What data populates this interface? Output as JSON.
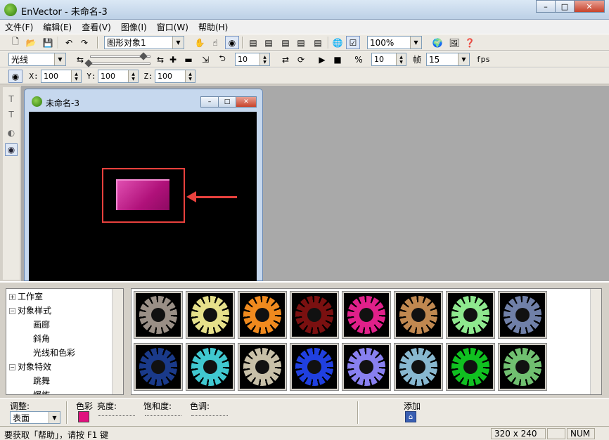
{
  "window": {
    "title": "EnVector - 未命名-3",
    "min": "–",
    "max": "□",
    "close": "✕"
  },
  "menu": [
    "文件(F)",
    "编辑(E)",
    "查看(V)",
    "图像(I)",
    "窗口(W)",
    "帮助(H)"
  ],
  "toolbar1": {
    "object_combo": "图形对象1",
    "zoom_combo": "100%"
  },
  "toolbar2": {
    "light_combo": "光线",
    "spin_a": "10",
    "spin_b": "10",
    "frame_label": "帧",
    "fps_combo": "15",
    "fps_label": "fps"
  },
  "toolbar3": {
    "x_label": "X:",
    "x_value": "100",
    "y_label": "Y:",
    "y_value": "100",
    "z_label": "Z:",
    "z_value": "100"
  },
  "doc": {
    "title": "未命名-3"
  },
  "tree": [
    {
      "label": "工作室",
      "box": "+",
      "level": 0
    },
    {
      "label": "对象样式",
      "box": "−",
      "level": 0
    },
    {
      "label": "画廊",
      "box": "",
      "level": 1
    },
    {
      "label": "斜角",
      "box": "",
      "level": 1
    },
    {
      "label": "光线和色彩",
      "box": "",
      "level": 1
    },
    {
      "label": "对象特效",
      "box": "−",
      "level": 0
    },
    {
      "label": "跳舞",
      "box": "",
      "level": 1
    },
    {
      "label": "爆炸",
      "box": "",
      "level": 1
    }
  ],
  "gallery_colors": [
    [
      "#9a8f86",
      "#e6e08a",
      "#f08a1e",
      "#7a1010",
      "#e0208a",
      "#c08850",
      "#8ee88e",
      "#7080a8"
    ],
    [
      "#1a3a8a",
      "#40c8d0",
      "#c8c0a8",
      "#2040e0",
      "#8880f0",
      "#88b8d0",
      "#10c020",
      "#70c070"
    ]
  ],
  "adjust": {
    "adjust_label": "调整:",
    "surface_combo": "表面",
    "color_label": "色彩",
    "brightness_label": "亮度:",
    "saturation_label": "饱和度:",
    "hue_label": "色调:",
    "add_label": "添加",
    "accent": "#e0117e"
  },
  "status": {
    "help_text": "要获取「帮助」，请按 F1 键",
    "size": "320 x 240",
    "num": "NUM"
  }
}
